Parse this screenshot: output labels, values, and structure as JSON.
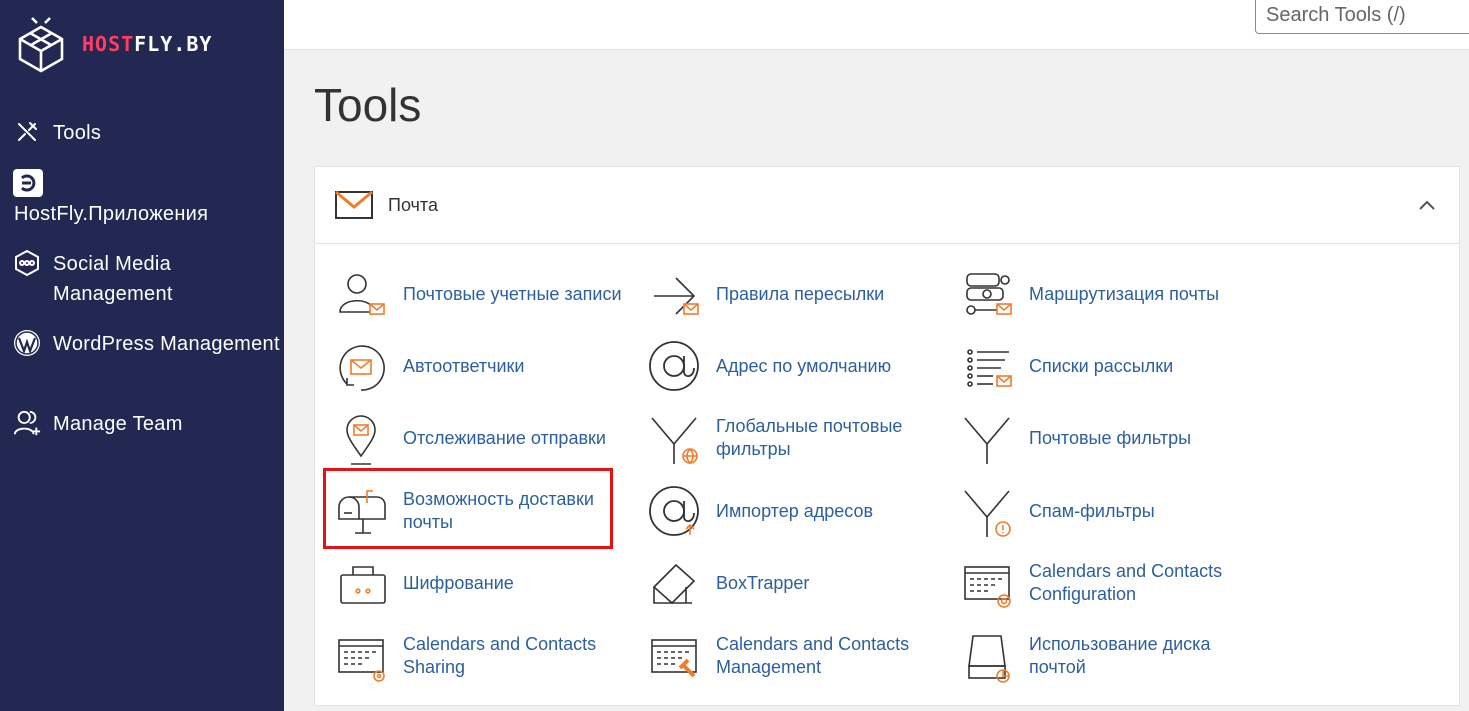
{
  "brand": {
    "part1": "HOST",
    "part2": "FLY.BY"
  },
  "search": {
    "placeholder": "Search Tools (/)"
  },
  "sidebar": {
    "items": [
      {
        "label": "Tools",
        "icon": "tools-icon"
      },
      {
        "label": "HostFly.Приложения",
        "icon": "apps-icon"
      },
      {
        "label": "Social Media Management",
        "icon": "social-icon"
      },
      {
        "label": "WordPress Management",
        "icon": "wordpress-icon"
      },
      {
        "label": "Manage Team",
        "icon": "team-icon"
      }
    ]
  },
  "page": {
    "title": "Tools"
  },
  "section": {
    "title": "Почта",
    "icon": "envelope-icon",
    "expanded": true
  },
  "tools": {
    "col1": [
      {
        "label": "Почтовые учетные записи",
        "icon": "email-accounts-icon"
      },
      {
        "label": "Автоответчики",
        "icon": "autoresponders-icon"
      },
      {
        "label": "Отслеживание отправки",
        "icon": "track-delivery-icon"
      },
      {
        "label": "Возможность доставки почты",
        "icon": "email-deliverability-icon"
      },
      {
        "label": "Шифрование",
        "icon": "encryption-icon"
      },
      {
        "label": "Calendars and Contacts Sharing",
        "icon": "calendar-sharing-icon"
      }
    ],
    "col2": [
      {
        "label": "Правила пересылки",
        "icon": "forwarders-icon"
      },
      {
        "label": "Адрес по умолчанию",
        "icon": "default-address-icon"
      },
      {
        "label": "Глобальные почтовые фильтры",
        "icon": "global-filters-icon"
      },
      {
        "label": "Импортер адресов",
        "icon": "address-importer-icon"
      },
      {
        "label": "BoxTrapper",
        "icon": "boxtrapper-icon"
      },
      {
        "label": "Calendars and Contacts Management",
        "icon": "calendar-management-icon"
      }
    ],
    "col3": [
      {
        "label": "Маршрутизация почты",
        "icon": "email-routing-icon"
      },
      {
        "label": "Списки рассылки",
        "icon": "mailing-lists-icon"
      },
      {
        "label": "Почтовые фильтры",
        "icon": "email-filters-icon"
      },
      {
        "label": "Спам-фильтры",
        "icon": "spam-filters-icon"
      },
      {
        "label": "Calendars and Contacts Configuration",
        "icon": "calendar-config-icon"
      },
      {
        "label": "Использование диска почтой",
        "icon": "disk-usage-icon"
      }
    ]
  },
  "colors": {
    "sidebar": "#232852",
    "link": "#2c5f9e",
    "accent": "#f07c2c",
    "brand": "#ff3d63",
    "highlight": "#e41414"
  }
}
